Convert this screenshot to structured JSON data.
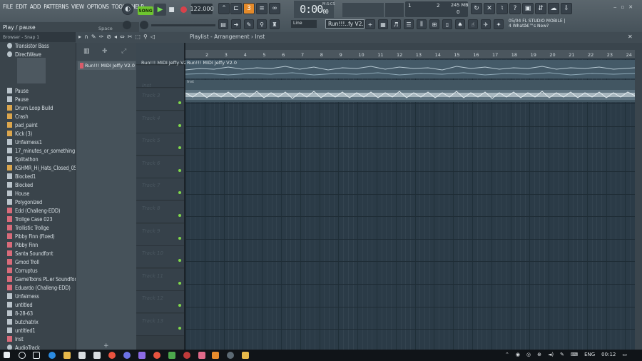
{
  "menu": [
    "FILE",
    "EDIT",
    "ADD",
    "PATTERNS",
    "VIEW",
    "OPTIONS",
    "TOOLS",
    "HELP"
  ],
  "hint": "Play / pause",
  "space_label": "Space",
  "transport": {
    "mode": "SONG",
    "tempo": "122.000"
  },
  "time": {
    "main": "0:00",
    "sub": "00",
    "label": "M:S:CS"
  },
  "perf": {
    "memory": "245 MB",
    "one": "1",
    "two": "2",
    "zero": "0"
  },
  "news": {
    "line1": "05/04  FL STUDIO MOBILE |",
    "line2": "4 Whatâ€™s New?"
  },
  "pattern_selector": "Run!!!..fy V2.0",
  "snap": "Line",
  "browser": {
    "header": "Browser - Snap 1",
    "items": [
      {
        "label": "Transistor Bass",
        "icon": "plug"
      },
      {
        "label": "DirectWave",
        "icon": "plug"
      },
      {
        "label": "Pause",
        "icon": "file"
      },
      {
        "label": "Pause",
        "icon": "file"
      },
      {
        "label": "Drum Loop Build",
        "icon": "wav"
      },
      {
        "label": "Crash",
        "icon": "wav"
      },
      {
        "label": "pad_paint",
        "icon": "wav"
      },
      {
        "label": "Kick (3)",
        "icon": "wav"
      },
      {
        "label": "Unfairness1",
        "icon": "file"
      },
      {
        "label": "17_minutes_or_something",
        "icon": "file"
      },
      {
        "label": "Splitathon",
        "icon": "file"
      },
      {
        "label": "KSHMR_Hi_Hats_Closed_05",
        "icon": "wav"
      },
      {
        "label": "Blocked1",
        "icon": "file"
      },
      {
        "label": "Blocked",
        "icon": "file"
      },
      {
        "label": "House",
        "icon": "file"
      },
      {
        "label": "Polygonized",
        "icon": "file"
      },
      {
        "label": "Edd (Challeng-EDD)",
        "icon": "pat"
      },
      {
        "label": "Trollge Case 023",
        "icon": "pat"
      },
      {
        "label": "Trollistic Trollge",
        "icon": "pat"
      },
      {
        "label": "Pibby Finn (Fixed)",
        "icon": "pat"
      },
      {
        "label": "Pibby Finn",
        "icon": "pat"
      },
      {
        "label": "Santa Soundfont",
        "icon": "pat"
      },
      {
        "label": "Gmod Troll",
        "icon": "pat"
      },
      {
        "label": "Corruptus",
        "icon": "pat"
      },
      {
        "label": "GameToons PL.er Soundfont",
        "icon": "pat"
      },
      {
        "label": "Eduardo (Challeng-EDD)",
        "icon": "pat"
      },
      {
        "label": "Unfairness",
        "icon": "file"
      },
      {
        "label": "untitled",
        "icon": "file"
      },
      {
        "label": "8-28-63",
        "icon": "file"
      },
      {
        "label": "butchatrix",
        "icon": "file"
      },
      {
        "label": "untitled1",
        "icon": "file"
      },
      {
        "label": "Inst",
        "icon": "pat"
      },
      {
        "label": "AudioTrack",
        "icon": "plug"
      }
    ]
  },
  "picker": {
    "item": "Run!!! MIDI Jeffy V2.0"
  },
  "playlist": {
    "title": "Playlist - Arrangement › Inst",
    "clip1": "Run!!! MIDI Jeffy V2.0",
    "clip2": "Inst",
    "track1_label": "Run!!! MIDI Jeffy V2.0",
    "track2_label": "Inst",
    "tracks": [
      "Track 3",
      "Track 4",
      "Track 5",
      "Track 6",
      "Track 7",
      "Track 8",
      "Track 9",
      "Track 10",
      "Track 11",
      "Track 12",
      "Track 13"
    ],
    "bars": [
      "2",
      "3",
      "4",
      "5",
      "6",
      "7",
      "8",
      "9",
      "10",
      "11",
      "12",
      "13",
      "14",
      "15",
      "16",
      "17",
      "18",
      "19",
      "20",
      "21",
      "22",
      "23",
      "24"
    ]
  },
  "taskbar": {
    "lang": "ENG",
    "clock": "00:12"
  },
  "colors": {
    "accent_green": "#6ec62f",
    "record_red": "#d8424b",
    "grid": "#2b3b47"
  }
}
